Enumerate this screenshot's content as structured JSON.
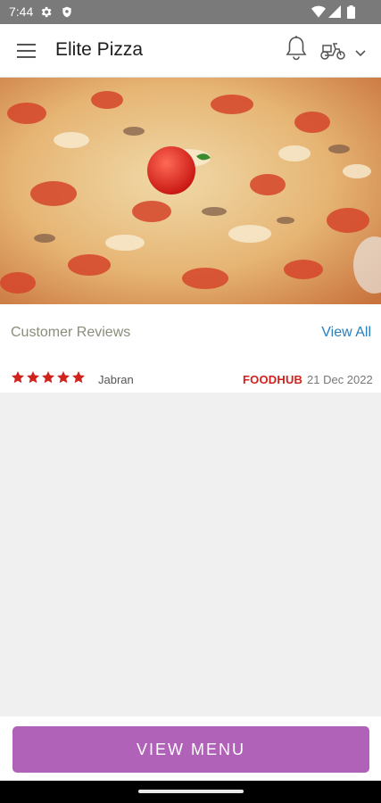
{
  "status_bar": {
    "time": "7:44",
    "icons": [
      "gear-icon",
      "shield-icon",
      "wifi-icon",
      "signal-icon",
      "battery-icon"
    ]
  },
  "app_bar": {
    "title": "Elite Pizza",
    "icons": [
      "hamburger-menu-icon",
      "notification-bell-icon",
      "delivery-scooter-icon",
      "chevron-down-icon"
    ]
  },
  "hero": {
    "image": "pizza-photo"
  },
  "reviews": {
    "heading": "Customer Reviews",
    "view_all_label": "View All",
    "items": [
      {
        "rating": 5,
        "rating_max": 5,
        "reviewer": "Jabran",
        "source": "FOODHUB",
        "date": "21 Dec 2022"
      }
    ]
  },
  "footer": {
    "view_menu_label": "VIEW MENU"
  },
  "colors": {
    "accent": "#b062b8",
    "link": "#2a7fbf",
    "star": "#d0231d",
    "status_bar": "#7a7a7a"
  }
}
